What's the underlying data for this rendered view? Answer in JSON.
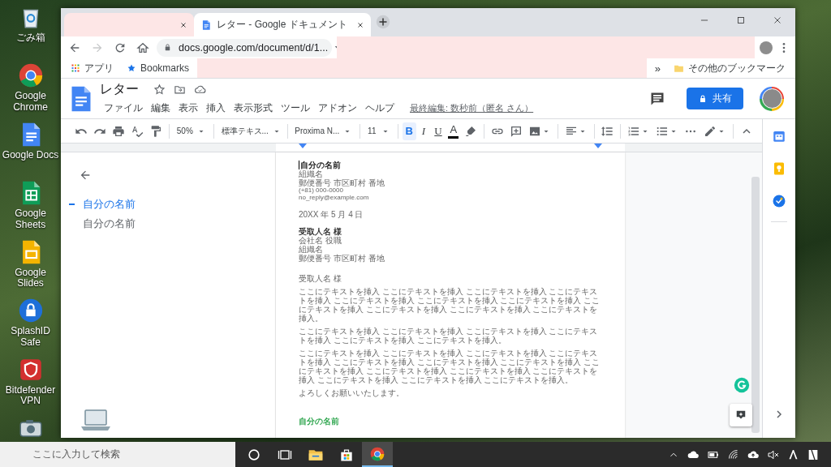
{
  "desktop": {
    "shortcuts": [
      {
        "kind": "trash",
        "label": "ごみ箱"
      },
      {
        "kind": "chrome",
        "label": "Google Chrome"
      },
      {
        "kind": "docs",
        "label": "Google Docs"
      },
      {
        "kind": "sheets",
        "label": "Google Sheets"
      },
      {
        "kind": "slides",
        "label": "Google Slides"
      },
      {
        "kind": "lock",
        "label": "SplashID Safe"
      },
      {
        "kind": "vpn",
        "label": "Bitdefender VPN"
      },
      {
        "kind": "camera"
      }
    ]
  },
  "browser": {
    "tabs": [
      {
        "redacted": true,
        "selected": false
      },
      {
        "redacted": false,
        "title": "レター - Google ドキュメント",
        "selected": true
      }
    ],
    "forward_disabled": true,
    "address": "docs.google.com/document/d/1...",
    "bookmarks": [
      {
        "kind": "apps",
        "label": "アプリ"
      },
      {
        "kind": "star",
        "label": "Bookmarks"
      }
    ],
    "overflow": "»",
    "other_bookmarks": "その他のブックマーク"
  },
  "docs": {
    "title": "レター",
    "menu": [
      "ファイル",
      "編集",
      "表示",
      "挿入",
      "表示形式",
      "ツール",
      "アドオン",
      "ヘルプ"
    ],
    "last_edit": "最終編集: 数秒前（匿名 さん）",
    "share": "共有",
    "toolbar": {
      "zoom": "50%",
      "style": "標準テキス...",
      "font": "Proxima N...",
      "size": "11",
      "format": [
        {
          "kind": "bold",
          "label": "B",
          "selected": true
        },
        {
          "kind": "italic",
          "label": "I",
          "selected": false
        },
        {
          "kind": "underline",
          "label": "U",
          "selected": false
        }
      ],
      "text_color": "A"
    },
    "outline": [
      {
        "text": "自分の名前",
        "selected": true
      },
      {
        "text": "自分の名前",
        "selected": false
      }
    ],
    "document": [
      {
        "kind": "name",
        "text": "自分の名前"
      },
      {
        "kind": "line",
        "text": "組織名"
      },
      {
        "kind": "line",
        "text": "郵便番号 市区町村 番地"
      },
      {
        "kind": "small",
        "text": "(+81) 000-0000"
      },
      {
        "kind": "small",
        "text": "no_reply@example.com"
      },
      {
        "kind": "date",
        "text": "20XX 年 5 月 4 日"
      },
      {
        "kind": "recipient",
        "text": "受取人名 様"
      },
      {
        "kind": "line",
        "text": "会社名 役職"
      },
      {
        "kind": "line",
        "text": "組織名"
      },
      {
        "kind": "line",
        "text": "郵便番号 市区町村 番地"
      },
      {
        "kind": "greeting",
        "text": "受取人名 様"
      },
      {
        "kind": "para",
        "text": "ここにテキストを挿入 ここにテキストを挿入 ここにテキストを挿入 ここにテキストを挿入 ここにテキストを挿入 ここにテキストを挿入 ここにテキストを挿入 ここにテキストを挿入 ここにテキストを挿入 ここにテキストを挿入 ここにテキストを挿入。"
      },
      {
        "kind": "para",
        "text": "ここにテキストを挿入 ここにテキストを挿入 ここにテキストを挿入 ここにテキストを挿入 ここにテキストを挿入 ここにテキストを挿入。"
      },
      {
        "kind": "para",
        "text": "ここにテキストを挿入 ここにテキストを挿入 ここにテキストを挿入 ここにテキストを挿入 ここにテキストを挿入 ここにテキストを挿入 ここにテキストを挿入 ここにテキストを挿入 ここにテキストを挿入 ここにテキストを挿入 ここにテキストを挿入 ここにテキストを挿入 ここにテキストを挿入 ここにテキストを挿入。"
      },
      {
        "kind": "closing",
        "text": "よろしくお願いいたします。"
      },
      {
        "kind": "signature",
        "text": "自分の名前"
      }
    ]
  },
  "taskbar": {
    "search_placeholder": "ここに入力して検索",
    "apps": [
      {
        "kind": "cortana",
        "selected": false
      },
      {
        "kind": "task-view",
        "selected": false
      },
      {
        "kind": "explorer",
        "selected": false
      },
      {
        "kind": "store",
        "selected": false
      },
      {
        "kind": "chrome",
        "selected": true
      }
    ]
  }
}
